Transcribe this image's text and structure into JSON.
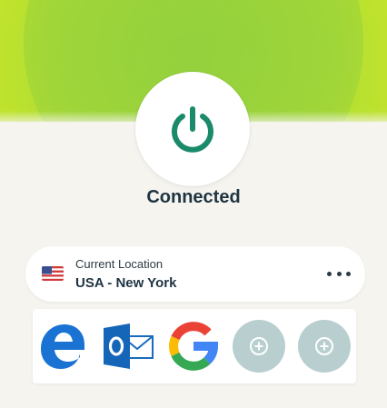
{
  "status": {
    "text": "Connected"
  },
  "location": {
    "caption": "Current Location",
    "name": "USA - New York",
    "flag_icon": "us-flag-icon"
  },
  "shortcuts": [
    {
      "name": "Microsoft Edge",
      "icon": "edge-icon"
    },
    {
      "name": "Outlook",
      "icon": "outlook-icon"
    },
    {
      "name": "Google",
      "icon": "google-icon"
    },
    {
      "name": "Add shortcut",
      "icon": "plus-circle-icon"
    },
    {
      "name": "Add shortcut",
      "icon": "plus-circle-icon"
    }
  ],
  "colors": {
    "accent": "#1b8a6b",
    "status_text": "#1e3441",
    "background": "#f6f4ef",
    "glow": "#b6dd2e",
    "add_button": "#b9cfcf"
  }
}
